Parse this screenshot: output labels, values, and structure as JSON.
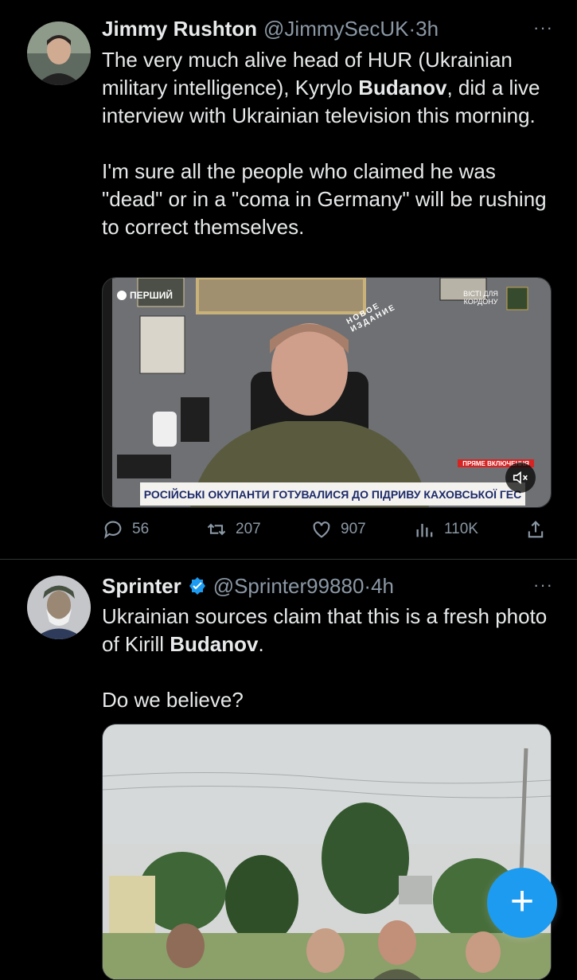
{
  "tweets": [
    {
      "name": "Jimmy Rushton",
      "handle": "@JimmySecUK",
      "separator": "·",
      "time": "3h",
      "more": "···",
      "text": {
        "p1_a": "The very much alive head of HUR (Ukrainian military intelligence), Kyrylo ",
        "p1_bold": "Budanov",
        "p1_b": ", did a live interview with Ukrainian television this morning.",
        "p2": "I'm sure all the people who claimed he was \"dead\" or in a \"coma in Germany\" will be rushing to correct themselves."
      },
      "media": {
        "ticker": "РОСІЙСЬКІ ОКУПАНТИ ГОТУВАЛИСЯ ДО ПІДРИВУ КАХОВСЬКОЇ ГЕС",
        "live_label": "ПРЯМЕ ВКЛЮЧЕННЯ",
        "channel": "ПЕРШИЙ",
        "top_right": "ВІСТІ ДЛЯ КОРДОНУ",
        "stamp": "НОВОЕ ИЗДАНИЕ"
      },
      "actions": {
        "replies": "56",
        "retweets": "207",
        "likes": "907",
        "views": "110K"
      }
    },
    {
      "name": "Sprinter",
      "handle": "@Sprinter99880",
      "separator": "·",
      "time": "4h",
      "more": "···",
      "text": {
        "p1_a": "Ukrainian sources claim that this is a fresh photo of Kirill ",
        "p1_bold": "Budanov",
        "p1_b": ".",
        "p2": "Do we believe?"
      }
    }
  ],
  "fab": {
    "label": "+"
  },
  "colors": {
    "accent": "#1d9bf0",
    "muted": "#8b98a5",
    "text": "#e7e9ea",
    "divider": "#2f3336"
  }
}
